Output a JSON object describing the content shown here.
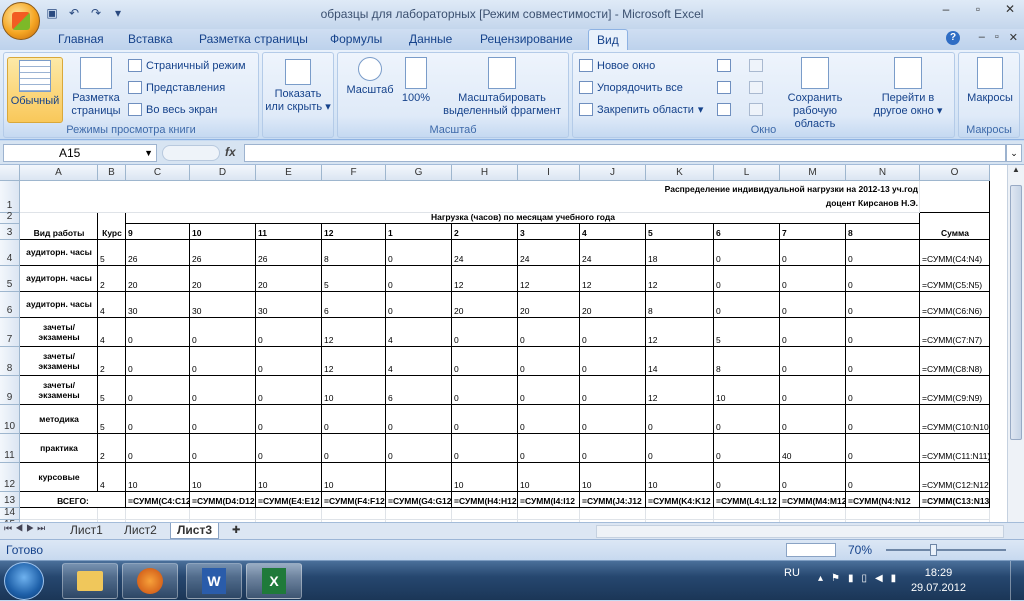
{
  "window": {
    "title": "образцы для лабораторных  [Режим совместимости] - Microsoft Excel"
  },
  "tabs": [
    "Главная",
    "Вставка",
    "Разметка страницы",
    "Формулы",
    "Данные",
    "Рецензирование",
    "Вид"
  ],
  "ribbon": {
    "views": {
      "normal": "Обычный",
      "page_layout": "Разметка страницы",
      "page_mode": "Страничный режим",
      "views": "Представления",
      "fullscreen": "Во весь экран",
      "label": "Режимы просмотра книги"
    },
    "show": {
      "label": "Показать или скрыть"
    },
    "zoom": {
      "zoom": "Масштаб",
      "percent": "100%",
      "fit": "Масштабировать выделенный фрагмент",
      "label": "Масштаб"
    },
    "window": {
      "new": "Новое окно",
      "arrange": "Упорядочить все",
      "freeze": "Закрепить области",
      "save": "Сохранить рабочую область",
      "switch": "Перейти в другое окно",
      "label": "Окно"
    },
    "macros": {
      "btn": "Макросы",
      "label": "Макросы"
    }
  },
  "formula_bar": {
    "namebox": "A15",
    "fx": "fx",
    "value": ""
  },
  "columns": [
    "A",
    "B",
    "C",
    "D",
    "E",
    "F",
    "G",
    "H",
    "I",
    "J",
    "K",
    "L",
    "M",
    "N",
    "O"
  ],
  "rows": [
    "1",
    "2",
    "3",
    "4",
    "5",
    "6",
    "7",
    "8",
    "9",
    "10",
    "11",
    "12",
    "13",
    "14",
    "15"
  ],
  "sheet": {
    "title1": "Распределение индивидуальной нагрузки на 2012-13 уч.год",
    "title2": "доцент Кирсанов Н.Э.",
    "h_work": "Вид работы",
    "h_course": "Курс",
    "h_load": "Нагрузка (часов) по месяцам учебного года",
    "h_sum": "Сумма",
    "months": [
      "9",
      "10",
      "11",
      "12",
      "1",
      "2",
      "3",
      "4",
      "5",
      "6",
      "7",
      "8"
    ],
    "data": [
      {
        "type": "аудиторн. часы",
        "course": "5",
        "v": [
          "26",
          "26",
          "26",
          "8",
          "0",
          "24",
          "24",
          "24",
          "18",
          "0",
          "0",
          "0"
        ],
        "sum": "=СУММ(C4:N4)"
      },
      {
        "type": "аудиторн. часы",
        "course": "2",
        "v": [
          "20",
          "20",
          "20",
          "5",
          "0",
          "12",
          "12",
          "12",
          "12",
          "0",
          "0",
          "0"
        ],
        "sum": "=СУММ(C5:N5)"
      },
      {
        "type": "аудиторн. часы",
        "course": "4",
        "v": [
          "30",
          "30",
          "30",
          "6",
          "0",
          "20",
          "20",
          "20",
          "8",
          "0",
          "0",
          "0"
        ],
        "sum": "=СУММ(C6:N6)"
      },
      {
        "type": "зачеты/ экзамены",
        "course": "4",
        "v": [
          "0",
          "0",
          "0",
          "12",
          "4",
          "0",
          "0",
          "0",
          "12",
          "5",
          "0",
          "0"
        ],
        "sum": "=СУММ(C7:N7)"
      },
      {
        "type": "зачеты/ экзамены",
        "course": "2",
        "v": [
          "0",
          "0",
          "0",
          "12",
          "4",
          "0",
          "0",
          "0",
          "14",
          "8",
          "0",
          "0"
        ],
        "sum": "=СУММ(C8:N8)"
      },
      {
        "type": "зачеты/ экзамены",
        "course": "5",
        "v": [
          "0",
          "0",
          "0",
          "10",
          "6",
          "0",
          "0",
          "0",
          "12",
          "10",
          "0",
          "0"
        ],
        "sum": "=СУММ(C9:N9)"
      },
      {
        "type": "методика",
        "course": "5",
        "v": [
          "0",
          "0",
          "0",
          "0",
          "0",
          "0",
          "0",
          "0",
          "0",
          "0",
          "0",
          "0"
        ],
        "sum": "=СУММ(C10:N10)"
      },
      {
        "type": "практика",
        "course": "2",
        "v": [
          "0",
          "0",
          "0",
          "0",
          "0",
          "0",
          "0",
          "0",
          "0",
          "0",
          "40",
          "0"
        ],
        "sum": "=СУММ(C11:N11)"
      },
      {
        "type": "курсовые",
        "course": "4",
        "v": [
          "10",
          "10",
          "10",
          "10",
          "",
          "10",
          "10",
          "10",
          "10",
          "0",
          "0",
          "0"
        ],
        "sum": "=СУММ(C12:N12)"
      }
    ],
    "total_label": "ВСЕГО:",
    "totals": [
      "=СУММ(C4:C12",
      "=СУММ(D4:D12",
      "=СУММ(E4:E12",
      "=СУММ(F4:F12",
      "=СУММ(G4:G12",
      "=СУММ(H4:H12",
      "=СУММ(I4:I12",
      "=СУММ(J4:J12",
      "=СУММ(K4:K12",
      "=СУММ(L4:L12",
      "=СУММ(M4:M12",
      "=СУММ(N4:N12",
      "=СУММ(C13:N13)"
    ]
  },
  "sheet_tabs": [
    "Лист1",
    "Лист2",
    "Лист3"
  ],
  "status": {
    "ready": "Готово",
    "zoom": "70%"
  },
  "taskbar": {
    "lang": "RU",
    "time": "18:29",
    "date": "29.07.2012"
  }
}
